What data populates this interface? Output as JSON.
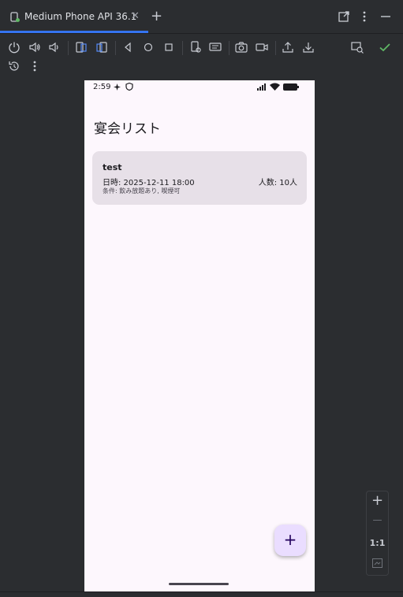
{
  "tab": {
    "title": "Medium Phone API 36.1",
    "close": "✕",
    "add": "+"
  },
  "window_actions": {
    "open_external": "open-external-icon",
    "more": "more-vertical-icon",
    "minimize": "minimize-icon"
  },
  "toolbar": {
    "icons": [
      "power-icon",
      "volume-up-icon",
      "volume-down-icon",
      "rotate-left-icon",
      "rotate-right-icon",
      "back-icon",
      "home-icon",
      "overview-icon",
      "device-settings-icon",
      "keyboard-icon",
      "camera-icon",
      "record-icon",
      "export-icon",
      "import-icon",
      "screen-mirror-icon",
      "check-icon",
      "reset-icon",
      "more-vertical-icon"
    ]
  },
  "device": {
    "status": {
      "time": "2:59"
    },
    "app_title": "宴会リスト",
    "cards": [
      {
        "title": "test",
        "date": "日時: 2025-12-11 18:00",
        "people": "人数: 10人",
        "conditions": "条件: 飲み放題あり, 喫煙可"
      }
    ],
    "fab_label": "+"
  },
  "zoom": {
    "plus": "+",
    "minus": "—",
    "ratio": "1:1"
  },
  "colors": {
    "accent": "#3574f0",
    "check": "#5fb865",
    "screen_bg": "#fdf7fd",
    "card_bg": "#e7e0e8",
    "fab_bg": "#eaddff"
  }
}
